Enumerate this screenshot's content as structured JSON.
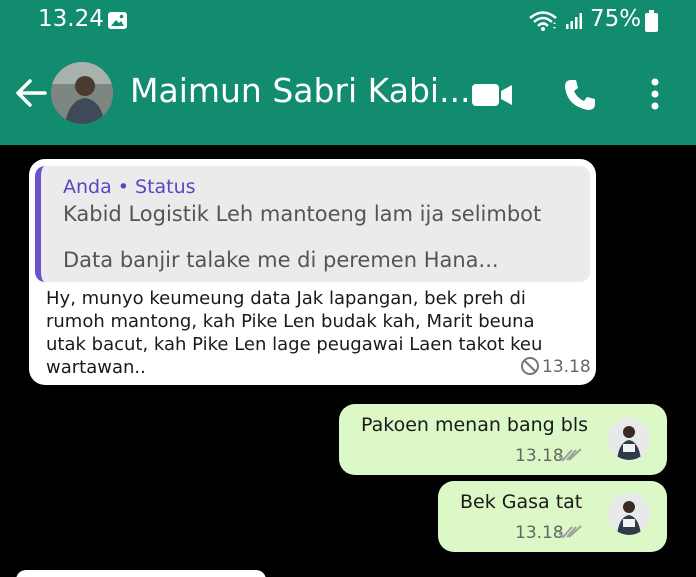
{
  "status_bar": {
    "time": "13.24",
    "battery": "75%"
  },
  "header": {
    "contact_name": "Maimun Sabri Kabi..."
  },
  "messages": {
    "incoming": {
      "quote_author": "Anda • Status",
      "quote_line1": "Kabid Logistik Leh mantoeng lam ija selimbot",
      "quote_line2": "Data banjir talake me di peremen Hana...",
      "text": "Hy, munyo keumeung data Jak lapangan, bek preh di rumoh mantong, kah Pike Len budak kah, Marit beuna utak bacut, kah Pike Len lage peugawai Laen takot keu wartawan..",
      "time": "13.18"
    },
    "outgoing": [
      {
        "text": "Pakoen menan bang bls",
        "time": "13.18"
      },
      {
        "text": "Bek Gasa tat",
        "time": "13.18"
      }
    ]
  },
  "colors": {
    "header": "#128c6e",
    "outgoing_bubble": "#dcf8c6",
    "incoming_bubble": "#ffffff",
    "quote_accent": "#6b52c8"
  }
}
